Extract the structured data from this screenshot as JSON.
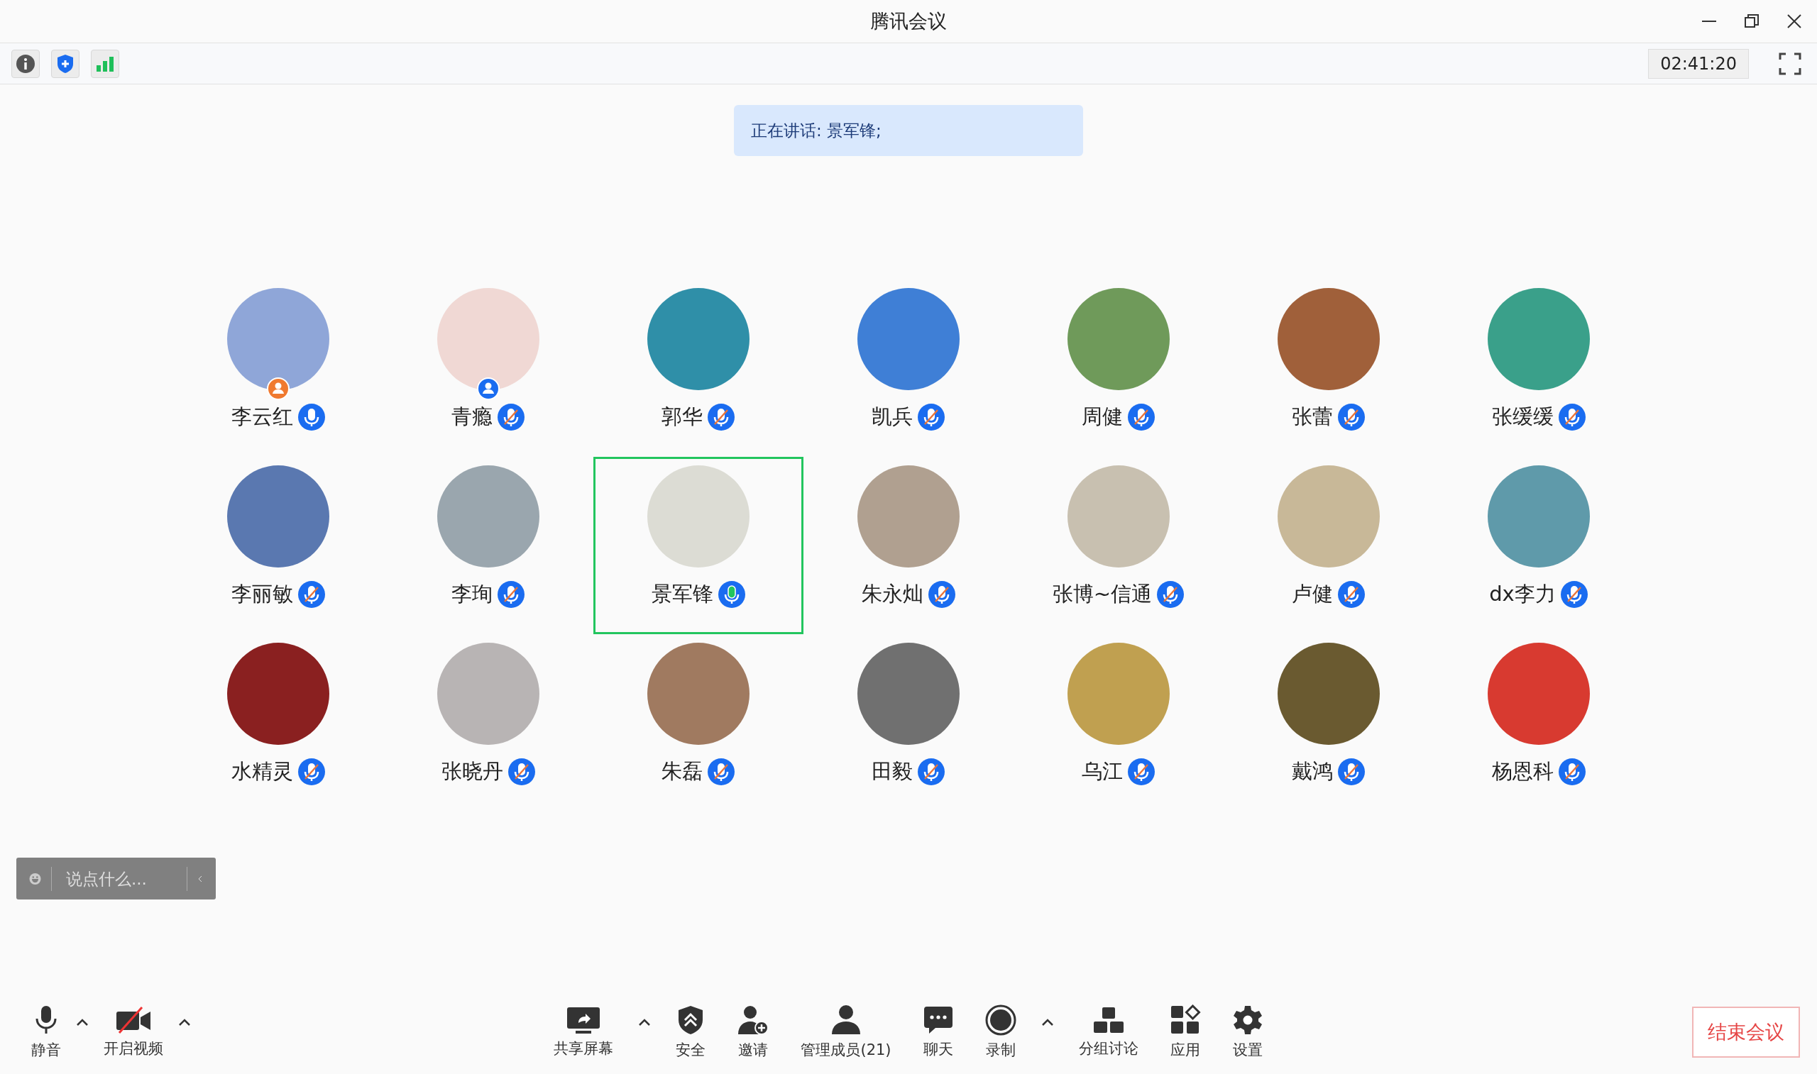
{
  "window": {
    "title": "腾讯会议"
  },
  "info_bar": {
    "timer": "02:41:20"
  },
  "speaking_banner": "正在讲话: 景军锋;",
  "participants": [
    {
      "name": "李云红",
      "muted": false,
      "speaking": false,
      "host": true,
      "cohost": false,
      "selected": false
    },
    {
      "name": "青瘾",
      "muted": true,
      "speaking": false,
      "host": false,
      "cohost": true,
      "selected": false
    },
    {
      "name": "郭华",
      "muted": true,
      "speaking": false,
      "host": false,
      "cohost": false,
      "selected": false
    },
    {
      "name": "凯兵",
      "muted": true,
      "speaking": false,
      "host": false,
      "cohost": false,
      "selected": false
    },
    {
      "name": "周健",
      "muted": true,
      "speaking": false,
      "host": false,
      "cohost": false,
      "selected": false
    },
    {
      "name": "张蕾",
      "muted": true,
      "speaking": false,
      "host": false,
      "cohost": false,
      "selected": false
    },
    {
      "name": "张缓缓",
      "muted": true,
      "speaking": false,
      "host": false,
      "cohost": false,
      "selected": false
    },
    {
      "name": "李丽敏",
      "muted": true,
      "speaking": false,
      "host": false,
      "cohost": false,
      "selected": false
    },
    {
      "name": "李珣",
      "muted": true,
      "speaking": false,
      "host": false,
      "cohost": false,
      "selected": false
    },
    {
      "name": "景军锋",
      "muted": false,
      "speaking": true,
      "host": false,
      "cohost": false,
      "selected": true
    },
    {
      "name": "朱永灿",
      "muted": true,
      "speaking": false,
      "host": false,
      "cohost": false,
      "selected": false
    },
    {
      "name": "张博~信通",
      "muted": true,
      "speaking": false,
      "host": false,
      "cohost": false,
      "selected": false
    },
    {
      "name": "卢健",
      "muted": true,
      "speaking": false,
      "host": false,
      "cohost": false,
      "selected": false
    },
    {
      "name": "dx李力",
      "muted": true,
      "speaking": false,
      "host": false,
      "cohost": false,
      "selected": false
    },
    {
      "name": "水精灵",
      "muted": true,
      "speaking": false,
      "host": false,
      "cohost": false,
      "selected": false
    },
    {
      "name": "张晓丹",
      "muted": true,
      "speaking": false,
      "host": false,
      "cohost": false,
      "selected": false
    },
    {
      "name": "朱磊",
      "muted": true,
      "speaking": false,
      "host": false,
      "cohost": false,
      "selected": false
    },
    {
      "name": "田毅",
      "muted": true,
      "speaking": false,
      "host": false,
      "cohost": false,
      "selected": false
    },
    {
      "name": "乌江",
      "muted": true,
      "speaking": false,
      "host": false,
      "cohost": false,
      "selected": false
    },
    {
      "name": "戴鸿",
      "muted": true,
      "speaking": false,
      "host": false,
      "cohost": false,
      "selected": false
    },
    {
      "name": "杨恩科",
      "muted": true,
      "speaking": false,
      "host": false,
      "cohost": false,
      "selected": false
    }
  ],
  "chat": {
    "placeholder": "说点什么..."
  },
  "toolbar": {
    "left": [
      {
        "kind": "mic",
        "label": "静音",
        "menu": true
      },
      {
        "kind": "video-off",
        "label": "开启视频",
        "menu": true
      }
    ],
    "center": [
      {
        "kind": "share",
        "label": "共享屏幕",
        "menu": true
      },
      {
        "kind": "security",
        "label": "安全",
        "menu": false
      },
      {
        "kind": "invite",
        "label": "邀请",
        "menu": false
      },
      {
        "kind": "members",
        "label": "管理成员(21)",
        "menu": false
      },
      {
        "kind": "chat",
        "label": "聊天",
        "menu": false
      },
      {
        "kind": "record",
        "label": "录制",
        "menu": true
      },
      {
        "kind": "breakout",
        "label": "分组讨论",
        "menu": false
      },
      {
        "kind": "apps",
        "label": "应用",
        "menu": false
      },
      {
        "kind": "settings",
        "label": "设置",
        "menu": false
      }
    ]
  },
  "end_button": "结束会议"
}
